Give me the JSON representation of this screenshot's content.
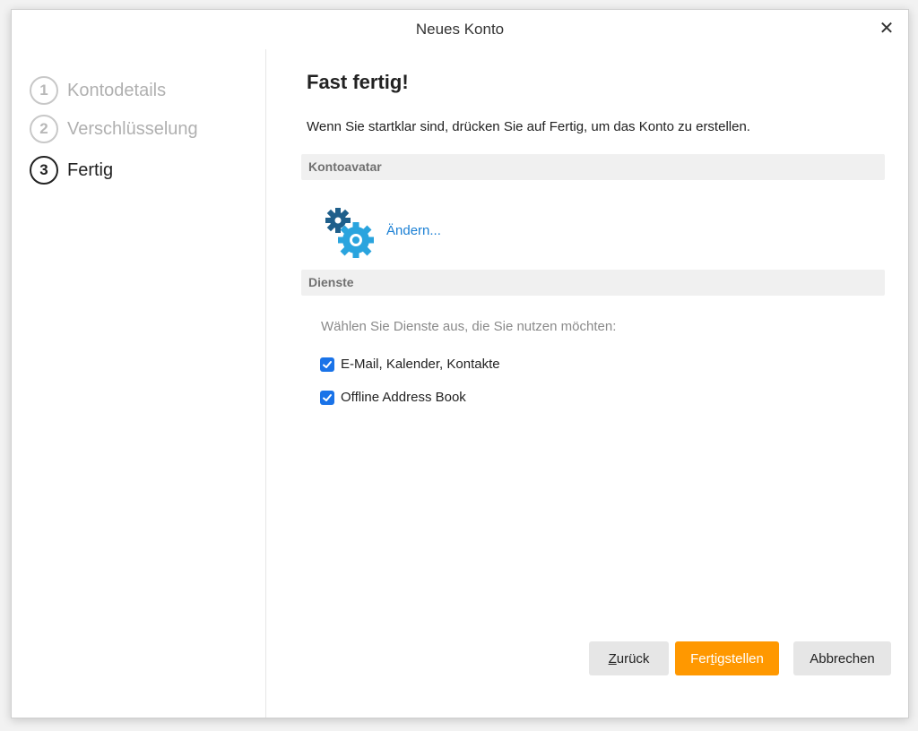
{
  "dialog": {
    "title": "Neues Konto",
    "close_icon": "close-icon"
  },
  "steps": [
    {
      "number": "1",
      "label": "Kontodetails",
      "state": "done"
    },
    {
      "number": "2",
      "label": "Verschlüsselung",
      "state": "done"
    },
    {
      "number": "3",
      "label": "Fertig",
      "state": "active"
    }
  ],
  "main": {
    "heading": "Fast fertig!",
    "intro": "Wenn Sie startklar sind, drücken Sie auf Fertig, um das Konto zu erstellen.",
    "avatar_section": {
      "title": "Kontoavatar",
      "icon": "gears-icon",
      "change_link": "Ändern..."
    },
    "services_section": {
      "title": "Dienste",
      "hint": "Wählen Sie Dienste aus, die Sie nutzen möchten:",
      "items": [
        {
          "label": "E-Mail, Kalender, Kontakte",
          "checked": true
        },
        {
          "label": "Offline Address Book",
          "checked": true
        }
      ]
    }
  },
  "buttons": {
    "back": {
      "mnemonic": "Z",
      "rest": "urück"
    },
    "finish": {
      "pre": "Fer",
      "mnemonic": "t",
      "rest": "igstellen"
    },
    "cancel": "Abbrechen"
  },
  "colors": {
    "accent": "#ff9800",
    "link": "#1a7fd4",
    "checkbox": "#1a73e8"
  }
}
